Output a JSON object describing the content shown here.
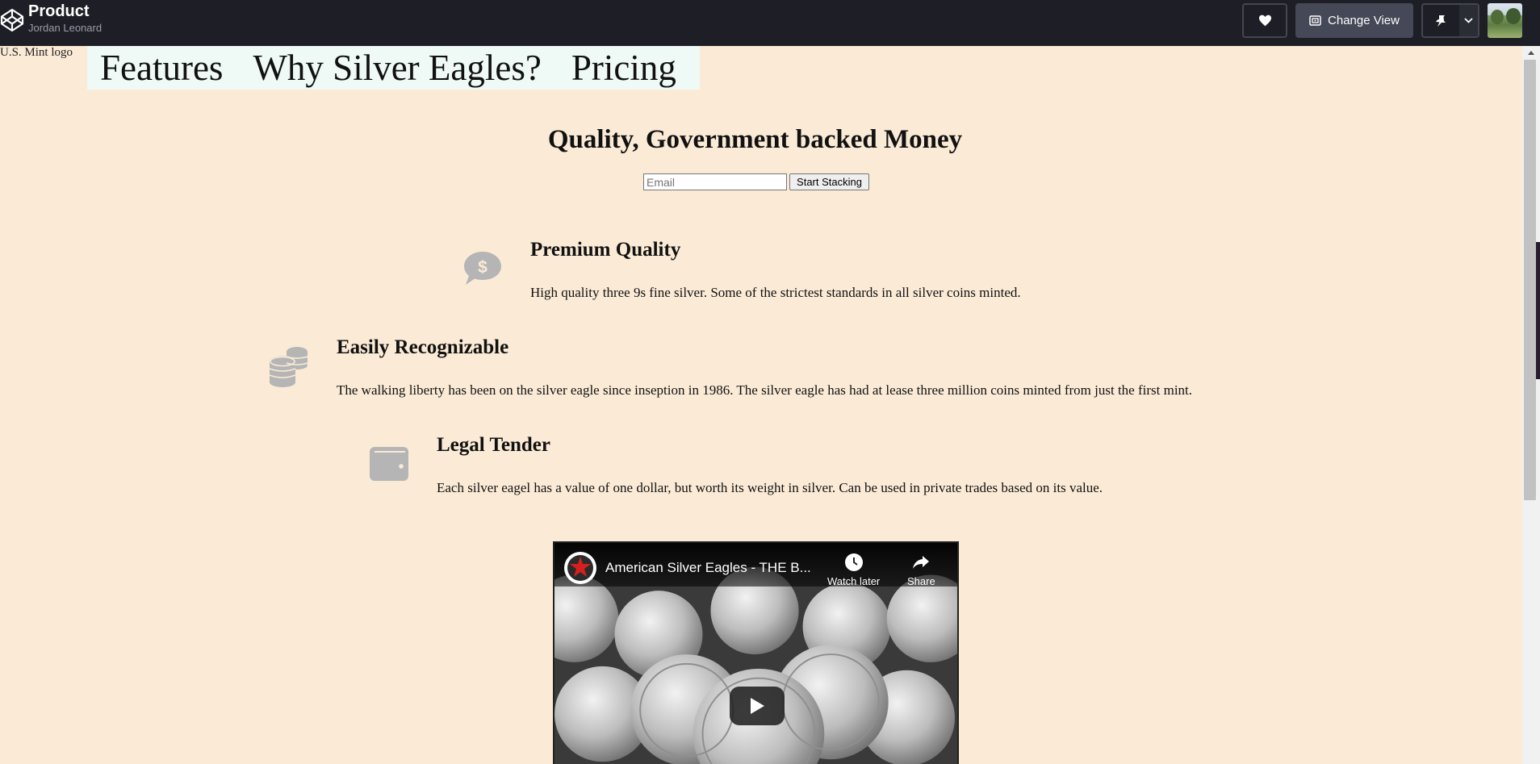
{
  "header": {
    "title": "Product",
    "author": "Jordan Leonard",
    "change_view_label": "Change View",
    "icons": [
      "codepen-logo-icon",
      "heart-icon",
      "change-view-icon",
      "pin-icon",
      "chevron-down-icon"
    ]
  },
  "page": {
    "logo_alt": "U.S. Mint logo",
    "nav": [
      "Features",
      "Why Silver Eagles?",
      "Pricing"
    ],
    "hero": {
      "title": "Quality, Government backed Money",
      "email_placeholder": "Email",
      "submit_label": "Start Stacking"
    },
    "features": [
      {
        "icon": "dollar-speech-bubble-icon",
        "title": "Premium Quality",
        "text": "High quality three 9s fine silver. Some of the strictest standards in all silver coins minted."
      },
      {
        "icon": "coins-stack-icon",
        "title": "Easily Recognizable",
        "text": "The walking liberty has been on the silver eagle since inseption in 1986. The silver eagle has had at lease three million coins minted from just the first mint."
      },
      {
        "icon": "wallet-icon",
        "title": "Legal Tender",
        "text": "Each silver eagel has a value of one dollar, but worth its weight in silver. Can be used in private trades based on its value."
      }
    ],
    "video": {
      "title": "American Silver Eagles - THE B...",
      "watch_later": "Watch later",
      "share": "Share"
    }
  },
  "colors": {
    "background": "#fbebd6",
    "topbar": "#1e1f26",
    "nav_background": "#effaf7",
    "icon_gray": "#b5b5b5"
  }
}
